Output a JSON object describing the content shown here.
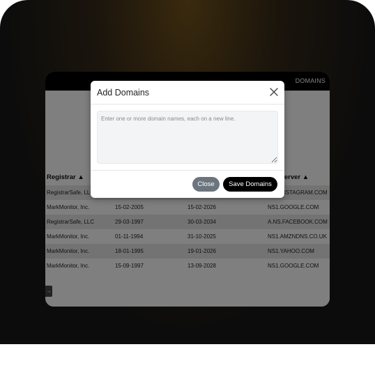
{
  "header": {
    "nav_domains": "DOMAINS"
  },
  "table": {
    "columns": [
      "Registrar ▲",
      "Name Server ▲"
    ],
    "rows": [
      [
        "RegistrarSafe, LLC",
        "",
        "",
        "NS1.INSTAGRAM.COM"
      ],
      [
        "MarkMonitor, Inc.",
        "15-02-2005",
        "15-02-2026",
        "NS1.GOOGLE.COM"
      ],
      [
        "RegistrarSafe, LLC",
        "29-03-1997",
        "30-03-2034",
        "A.NS.FACEBOOK.COM"
      ],
      [
        "MarkMonitor, Inc.",
        "01-11-1994",
        "31-10-2025",
        "NS1.AMZNDNS.CO.UK"
      ],
      [
        "MarkMonitor, Inc.",
        "18-01-1995",
        "19-01-2026",
        "NS1.YAHOO.COM"
      ],
      [
        "MarkMonitor, Inc.",
        "15-09-1997",
        "13-09-2028",
        "NS1.GOOGLE.COM"
      ]
    ]
  },
  "pager": {
    "next_label": "→"
  },
  "modal": {
    "title": "Add Domains",
    "textarea_placeholder": "Enter one or more domain names, each on a new line.",
    "textarea_value": "",
    "close_label": "Close",
    "save_label": "Save Domains"
  },
  "icons": {
    "close": "close-icon",
    "next": "arrow-right-icon"
  },
  "colors": {
    "save_button": "#000000",
    "close_button": "#6c757d",
    "overlay": "rgba(0,0,0,0.5)"
  }
}
